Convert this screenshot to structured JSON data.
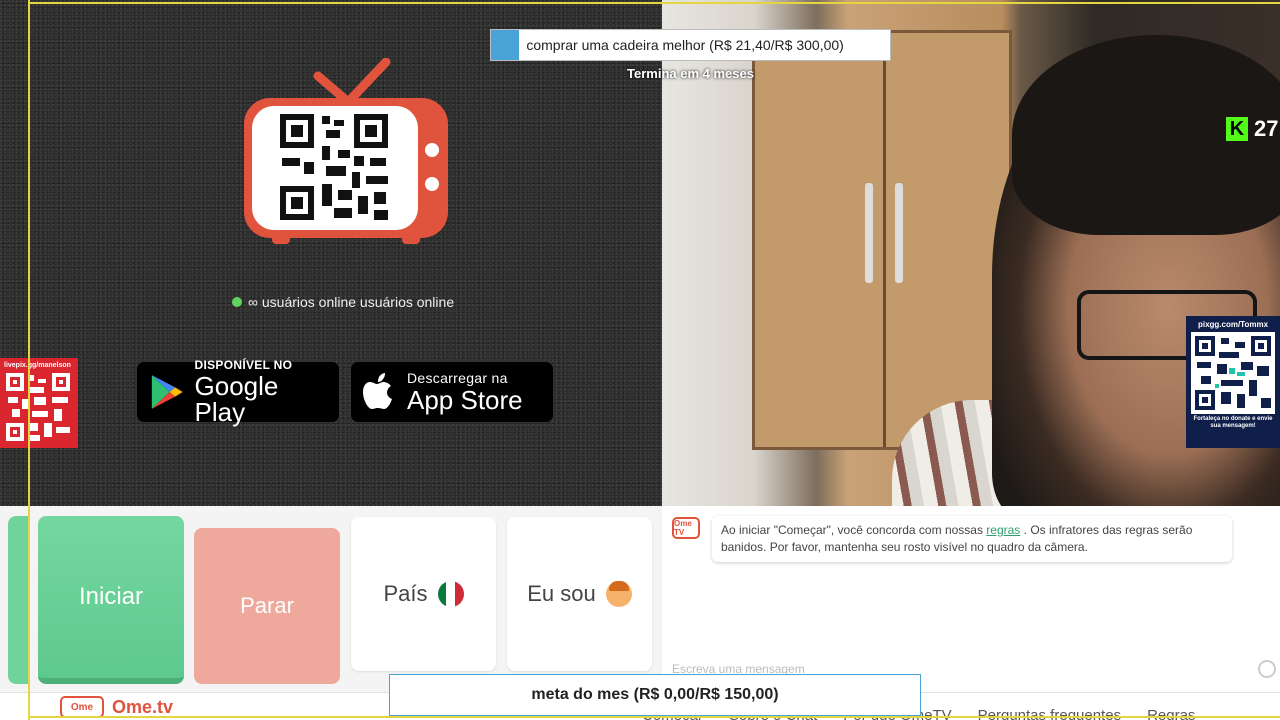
{
  "goal_top": {
    "text": "comprar uma cadeira melhor (R$ 21,40/R$ 300,00)",
    "progress_percent": 7.1,
    "ends": "Termina em 4 meses"
  },
  "online": {
    "text": "∞ usuários online usuários online"
  },
  "stores": {
    "google": {
      "small": "DISPONÍVEL NO",
      "big": "Google Play"
    },
    "apple": {
      "small": "Descarregar na",
      "big": "App Store"
    }
  },
  "left_qr": {
    "url": "livepix.gg/manelson"
  },
  "right_qr": {
    "url": "pixgg.com/Tommx",
    "footer": "Fortaleça no donate e envie sua mensagem!"
  },
  "kick": {
    "count": "27"
  },
  "controls": {
    "start": "Iniciar",
    "stop": "Parar",
    "country": "País",
    "i_am": "Eu sou"
  },
  "chat": {
    "logo": "Ome TV",
    "msg_before": "Ao iniciar \"Começar\", você concorda com nossas ",
    "msg_link": "regras",
    "msg_after": " . Os infratores das regras serão banidos. Por favor, mantenha seu rosto visível no quadro da câmera.",
    "input_placeholder": "Escreva uma mensagem"
  },
  "goal_bottom": {
    "text": "meta do mes (R$ 0,00/R$ 150,00)"
  },
  "footer": {
    "logo": "Ome",
    "brand": "Ome.tv",
    "links": [
      "Começar",
      "Sobre o Chat",
      "Por que OmeTV",
      "Perguntas frequentes",
      "Regras"
    ]
  },
  "colors": {
    "accent": "#e0533d",
    "start_green": "#5ec98d",
    "stop_red": "#eea89c",
    "goal_blue": "#4aa3d6",
    "frame_yellow": "#e3d640"
  }
}
